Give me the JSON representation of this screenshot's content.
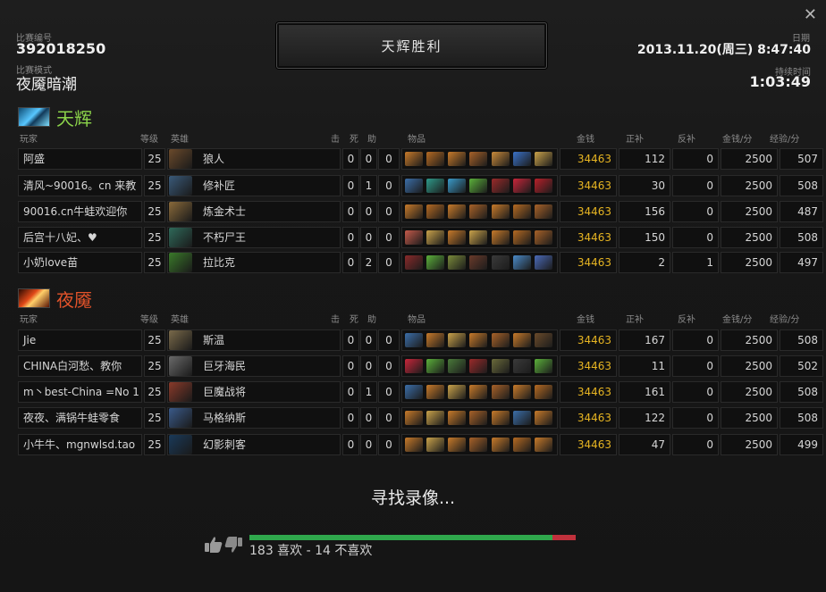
{
  "header": {
    "match_id_label": "比赛编号",
    "match_id": "392018250",
    "mode_label": "比赛模式",
    "mode": "夜魇暗潮",
    "result": "天辉胜利",
    "date_label": "日期",
    "date": "2013.11.20(周三) 8:47:40",
    "duration_label": "持续时间",
    "duration": "1:03:49",
    "close_symbol": "✕"
  },
  "columns": {
    "player": "玩家",
    "level": "等级",
    "hero": "英雄",
    "kills": "击",
    "deaths": "死",
    "assists": "助",
    "items": "物品",
    "gold": "金钱",
    "last_hits": "正补",
    "denies": "反补",
    "gpm": "金钱/分",
    "xpm": "经验/分"
  },
  "teams": [
    {
      "name": "天辉",
      "color": "#8bd34a",
      "players": [
        {
          "player": "阿盛",
          "level": "25",
          "hero": "狼人",
          "kills": "0",
          "deaths": "0",
          "assists": "0",
          "gold": "34463",
          "last_hits": "112",
          "denies": "0",
          "gpm": "2500",
          "xpm": "507"
        },
        {
          "player": "清风~90016。cn 来教",
          "level": "25",
          "hero": "修补匠",
          "kills": "0",
          "deaths": "1",
          "assists": "0",
          "gold": "34463",
          "last_hits": "30",
          "denies": "0",
          "gpm": "2500",
          "xpm": "508"
        },
        {
          "player": "90016.cn牛蛙欢迎你",
          "level": "25",
          "hero": "炼金术士",
          "kills": "0",
          "deaths": "0",
          "assists": "0",
          "gold": "34463",
          "last_hits": "156",
          "denies": "0",
          "gpm": "2500",
          "xpm": "487"
        },
        {
          "player": "后宫十八妃、♥",
          "level": "25",
          "hero": "不朽尸王",
          "kills": "0",
          "deaths": "0",
          "assists": "0",
          "gold": "34463",
          "last_hits": "150",
          "denies": "0",
          "gpm": "2500",
          "xpm": "508"
        },
        {
          "player": "小奶love苗",
          "level": "25",
          "hero": "拉比克",
          "kills": "0",
          "deaths": "2",
          "assists": "0",
          "gold": "34463",
          "last_hits": "2",
          "denies": "1",
          "gpm": "2500",
          "xpm": "497"
        }
      ]
    },
    {
      "name": "夜魇",
      "color": "#e3532a",
      "players": [
        {
          "player": "Jie",
          "level": "25",
          "hero": "斯温",
          "kills": "0",
          "deaths": "0",
          "assists": "0",
          "gold": "34463",
          "last_hits": "167",
          "denies": "0",
          "gpm": "2500",
          "xpm": "508"
        },
        {
          "player": "CHINA白河愁、教你",
          "level": "25",
          "hero": "巨牙海民",
          "kills": "0",
          "deaths": "0",
          "assists": "0",
          "gold": "34463",
          "last_hits": "11",
          "denies": "0",
          "gpm": "2500",
          "xpm": "502"
        },
        {
          "player": "m丶best-China =No 1",
          "level": "25",
          "hero": "巨魔战将",
          "kills": "0",
          "deaths": "1",
          "assists": "0",
          "gold": "34463",
          "last_hits": "161",
          "denies": "0",
          "gpm": "2500",
          "xpm": "508"
        },
        {
          "player": "夜夜、满锅牛蛙零食",
          "level": "25",
          "hero": "马格纳斯",
          "kills": "0",
          "deaths": "0",
          "assists": "0",
          "gold": "34463",
          "last_hits": "122",
          "denies": "0",
          "gpm": "2500",
          "xpm": "508"
        },
        {
          "player": "小牛牛、mgnwlsd.tao",
          "level": "25",
          "hero": "幻影刺客",
          "kills": "0",
          "deaths": "0",
          "assists": "0",
          "gold": "34463",
          "last_hits": "47",
          "denies": "0",
          "gpm": "2500",
          "xpm": "499"
        }
      ]
    }
  ],
  "footer": {
    "search_replay": "寻找录像...",
    "likes_text": "183 喜欢 - 14 不喜欢",
    "like_ratio": 0.929,
    "like_color": "#2fa84c",
    "dislike_color": "#c0313c"
  }
}
